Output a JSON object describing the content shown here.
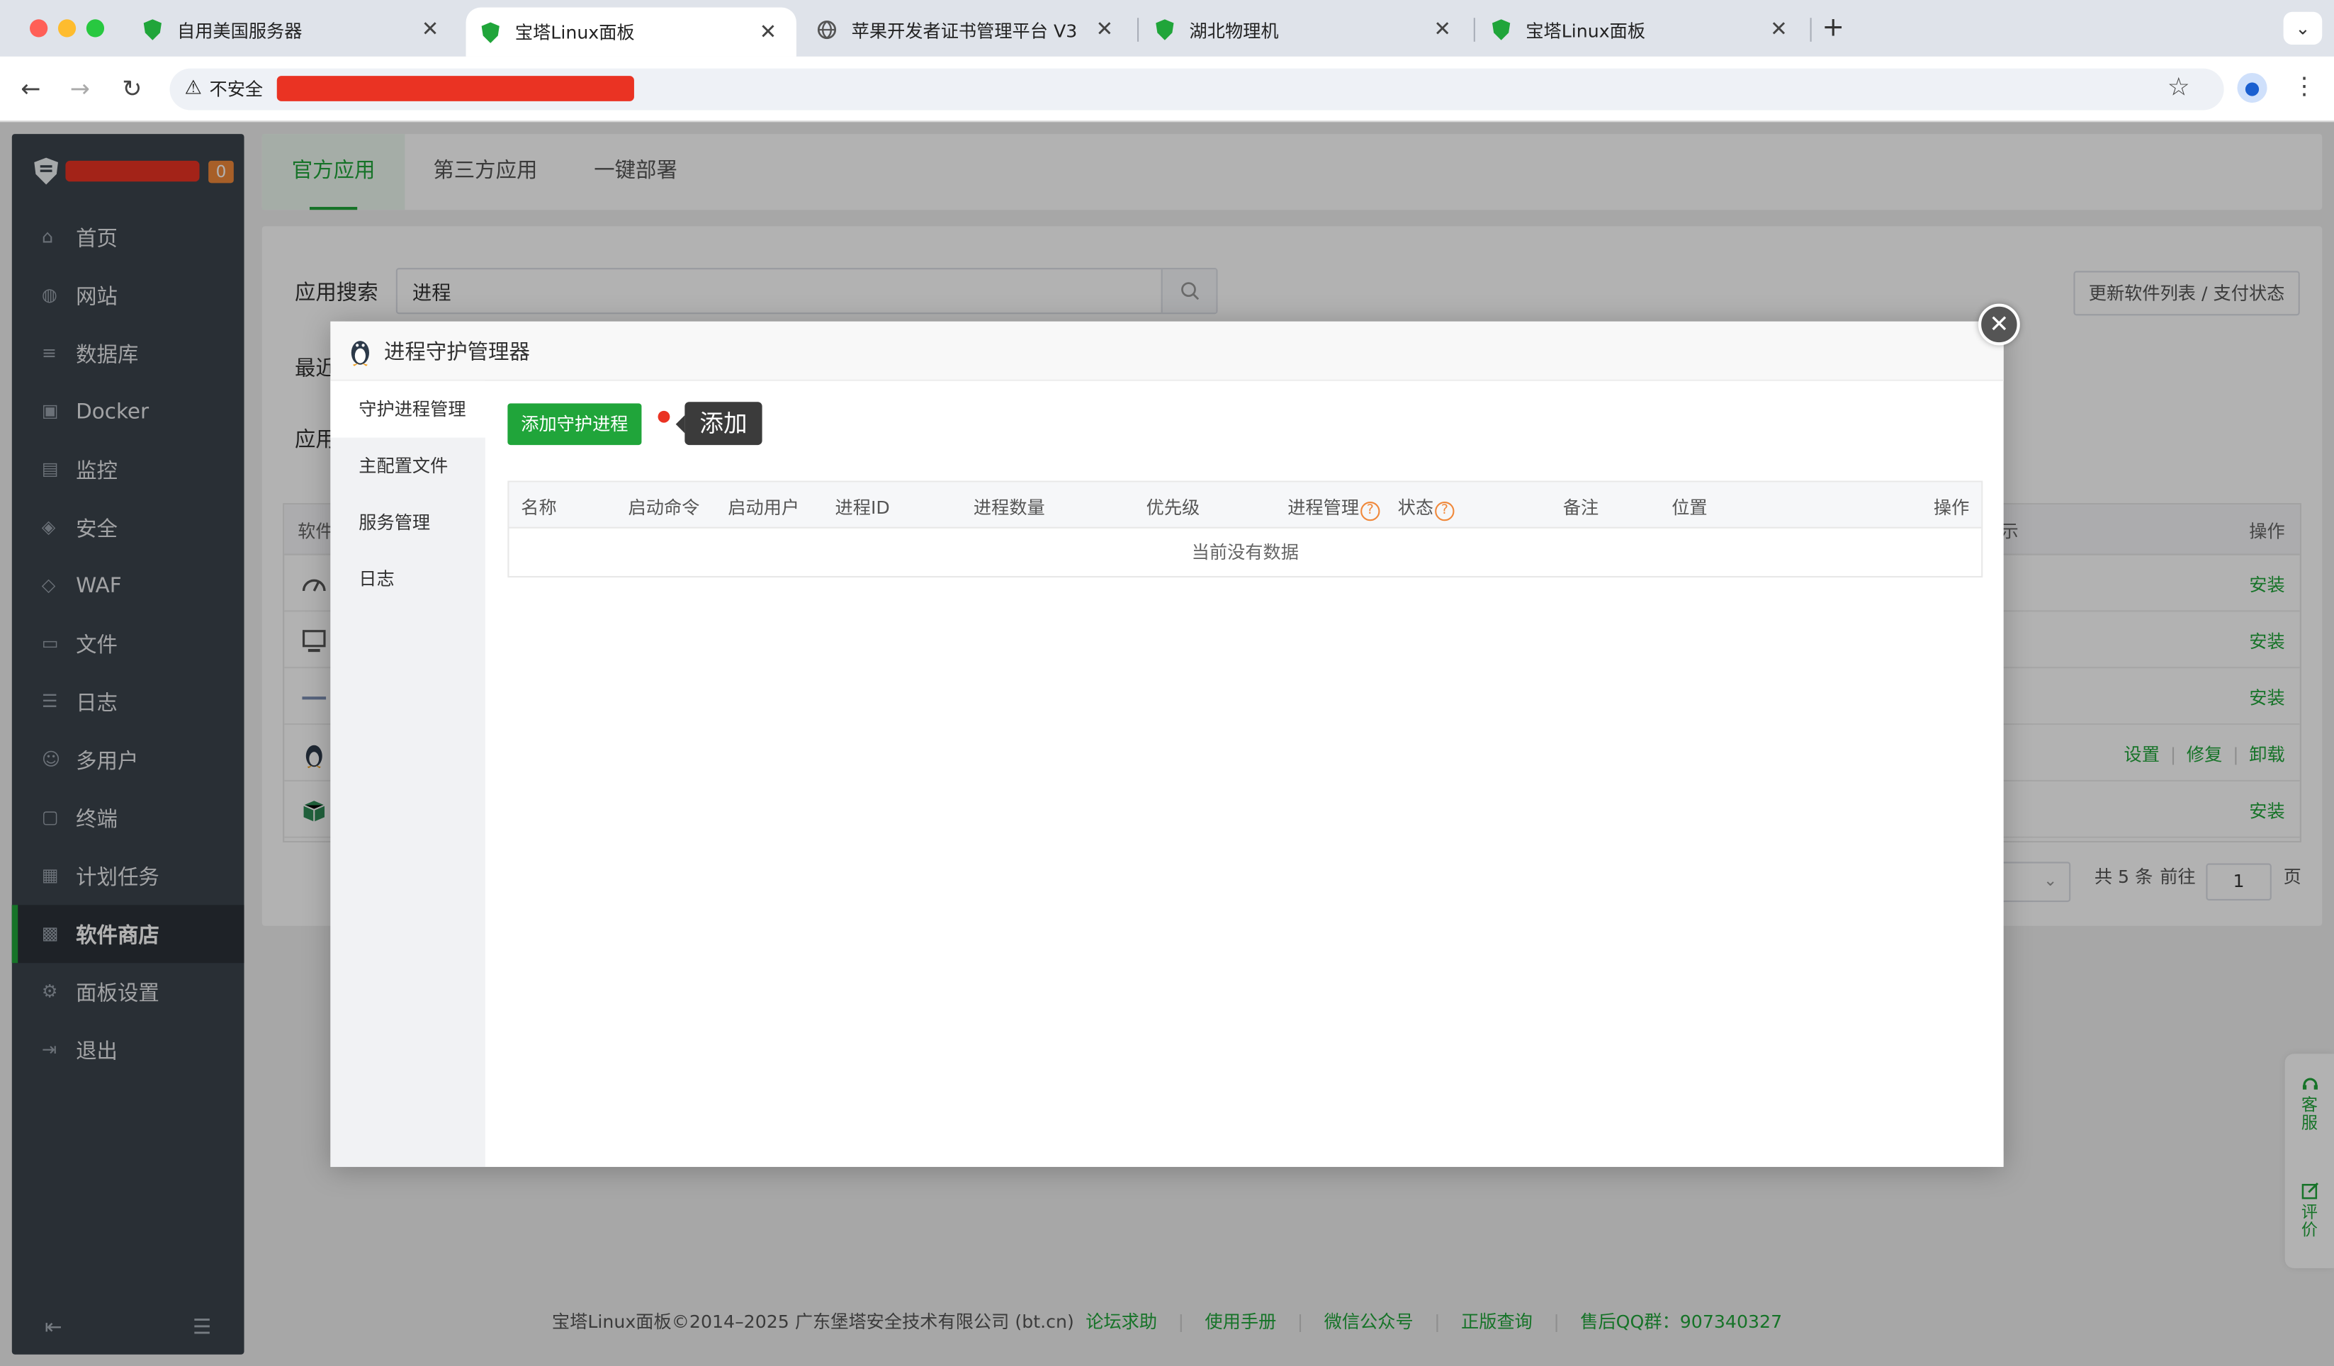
{
  "browser": {
    "tabs": [
      {
        "title": "自用美国服务器",
        "active": false
      },
      {
        "title": "宝塔Linux面板",
        "active": true
      },
      {
        "title": "苹果开发者证书管理平台 V3",
        "active": false
      },
      {
        "title": "湖北物理机",
        "active": false
      },
      {
        "title": "宝塔Linux面板",
        "active": false
      }
    ],
    "new_tab": "+",
    "insecure_label": "不安全"
  },
  "sidebar": {
    "badge": "0",
    "items": [
      {
        "label": "首页",
        "icon": "home-icon"
      },
      {
        "label": "网站",
        "icon": "globe-icon"
      },
      {
        "label": "数据库",
        "icon": "database-icon"
      },
      {
        "label": "Docker",
        "icon": "docker-icon"
      },
      {
        "label": "监控",
        "icon": "monitor-icon"
      },
      {
        "label": "安全",
        "icon": "shield-icon"
      },
      {
        "label": "WAF",
        "icon": "waf-icon"
      },
      {
        "label": "文件",
        "icon": "folder-icon"
      },
      {
        "label": "日志",
        "icon": "log-icon"
      },
      {
        "label": "多用户",
        "icon": "users-icon"
      },
      {
        "label": "终端",
        "icon": "terminal-icon"
      },
      {
        "label": "计划任务",
        "icon": "calendar-icon"
      },
      {
        "label": "软件商店",
        "icon": "apps-grid-icon",
        "active": true
      },
      {
        "label": "面板设置",
        "icon": "gear-icon"
      },
      {
        "label": "退出",
        "icon": "logout-icon"
      }
    ]
  },
  "main": {
    "tabs": [
      {
        "label": "官方应用",
        "active": true
      },
      {
        "label": "第三方应用",
        "active": false
      },
      {
        "label": "一键部署",
        "active": false
      }
    ],
    "search_label": "应用搜索",
    "search_value": "进程",
    "update_button": "更新软件列表 / 支付状态",
    "recent_label": "最近",
    "app_label": "应用",
    "table_header": {
      "software": "软件",
      "display": "示",
      "operation": "操作"
    },
    "rows": [
      {
        "icon": "gauge-icon",
        "actions": [
          "安装"
        ]
      },
      {
        "icon": "server-monitor-icon",
        "actions": [
          "安装"
        ]
      },
      {
        "icon": "tool-icon",
        "actions": [
          "安装"
        ]
      },
      {
        "icon": "penguin-icon",
        "actions": [
          "设置",
          "修复",
          "卸载"
        ]
      },
      {
        "icon": "package-icon",
        "actions": [
          "安装"
        ]
      }
    ],
    "pager": {
      "total": "共 5 条",
      "goto": "前往",
      "page": "1",
      "page_unit": "页"
    }
  },
  "footer": {
    "copyright": "宝塔Linux面板©2014–2025 广东堡塔安全技术有限公司 (bt.cn)",
    "links": [
      "论坛求助",
      "使用手册",
      "微信公众号",
      "正版查询",
      "售后QQ群：907340327"
    ]
  },
  "float_panel": {
    "service": "客服",
    "review": "评价"
  },
  "modal": {
    "title": "进程守护管理器",
    "nav": [
      {
        "label": "守护进程管理",
        "active": true
      },
      {
        "label": "主配置文件",
        "active": false
      },
      {
        "label": "服务管理",
        "active": false
      },
      {
        "label": "日志",
        "active": false
      }
    ],
    "add_button": "添加守护进程",
    "tooltip": "添加",
    "columns": [
      "名称",
      "启动命令",
      "启动用户",
      "进程ID",
      "进程数量",
      "优先级",
      "进程管理",
      "状态",
      "备注",
      "位置",
      "操作"
    ],
    "empty_text": "当前没有数据"
  },
  "colors": {
    "accent": "#20a53a",
    "sidebar_bg": "#3c444d",
    "redaction": "#ea3323",
    "badge": "#f0883a"
  }
}
